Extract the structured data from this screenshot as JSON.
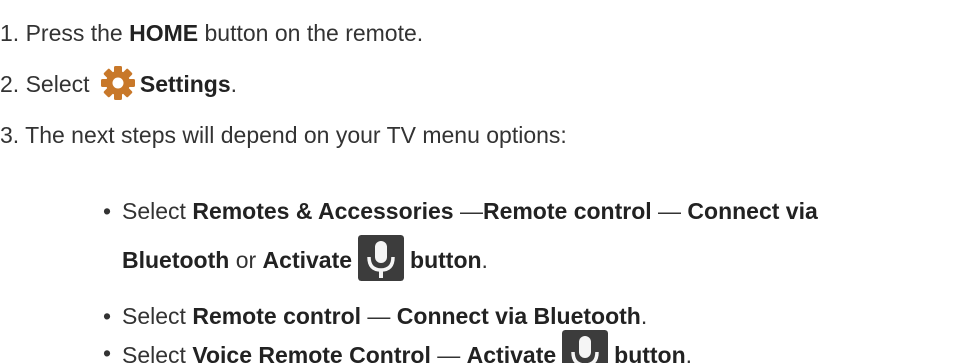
{
  "steps": {
    "step1": {
      "prefix": "1. Press the ",
      "bold": "HOME",
      "suffix": " button on the remote."
    },
    "step2": {
      "prefix": "2. Select ",
      "bold": "Settings",
      "suffix": "."
    },
    "step3": {
      "text": "3. The next steps will depend on your TV menu options:"
    }
  },
  "bullets": {
    "bullet_char": "•",
    "b1": {
      "select": "Select ",
      "bold1": "Remotes & Accessories",
      "sep1": " —",
      "bold2": "Remote control",
      "sep2": " — ",
      "bold3": "Connect via",
      "bold4": "Bluetooth",
      "or": " or ",
      "bold5": "Activate",
      "bold6": "button",
      "end": "."
    },
    "b2": {
      "select": "Select ",
      "bold1": "Remote control",
      "sep": " — ",
      "bold2": "Connect via Bluetooth",
      "end": "."
    },
    "b3": {
      "select": "Select ",
      "bold1": "Voice Remote Control",
      "sep": " — ",
      "bold2": "Activate",
      "bold3": "button",
      "end": "."
    }
  },
  "icons": {
    "settings": "gear-icon",
    "voice": "microphone-icon"
  },
  "colors": {
    "gear": "#c8782a",
    "mic_bg": "#3c3c3c",
    "mic_fg": "#f5f5f5"
  }
}
